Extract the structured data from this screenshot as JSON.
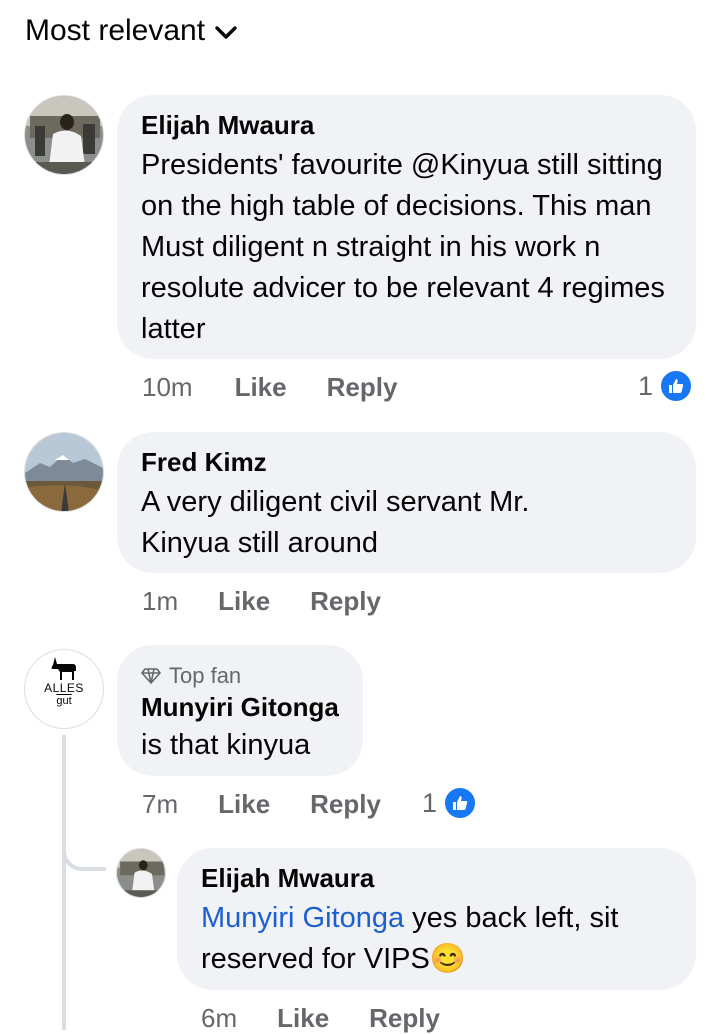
{
  "sort": {
    "label": "Most relevant"
  },
  "comments": [
    {
      "author": "Elijah Mwaura",
      "text": "Presidents' favourite @Kinyua still sitting on the high table of decisions. This man Must diligent n straight in his work n resolute advicer to be relevant 4 regimes latter",
      "time": "10m",
      "like_label": "Like",
      "reply_label": "Reply",
      "reaction_count": "1"
    },
    {
      "author": "Fred Kimz",
      "text": "A very diligent civil servant Mr. Kinyua still around",
      "time": "1m",
      "like_label": "Like",
      "reply_label": "Reply"
    },
    {
      "badge": "Top fan",
      "author": "Munyiri Gitonga",
      "text": "is that kinyua",
      "time": "7m",
      "like_label": "Like",
      "reply_label": "Reply",
      "reaction_count": "1",
      "avatar_text": "ALLES",
      "avatar_subtext": "gut",
      "replies": [
        {
          "author": "Elijah Mwaura",
          "mention": "Munyiri Gitonga",
          "text": " yes back left, sit reserved for VIPS",
          "emoji": "😊",
          "time": "6m",
          "like_label": "Like",
          "reply_label": "Reply"
        }
      ]
    }
  ],
  "colors": {
    "like_blue": "#1877f2",
    "mention": "#1b5fd3",
    "bubble": "#f0f2f5",
    "meta": "#65676b"
  }
}
